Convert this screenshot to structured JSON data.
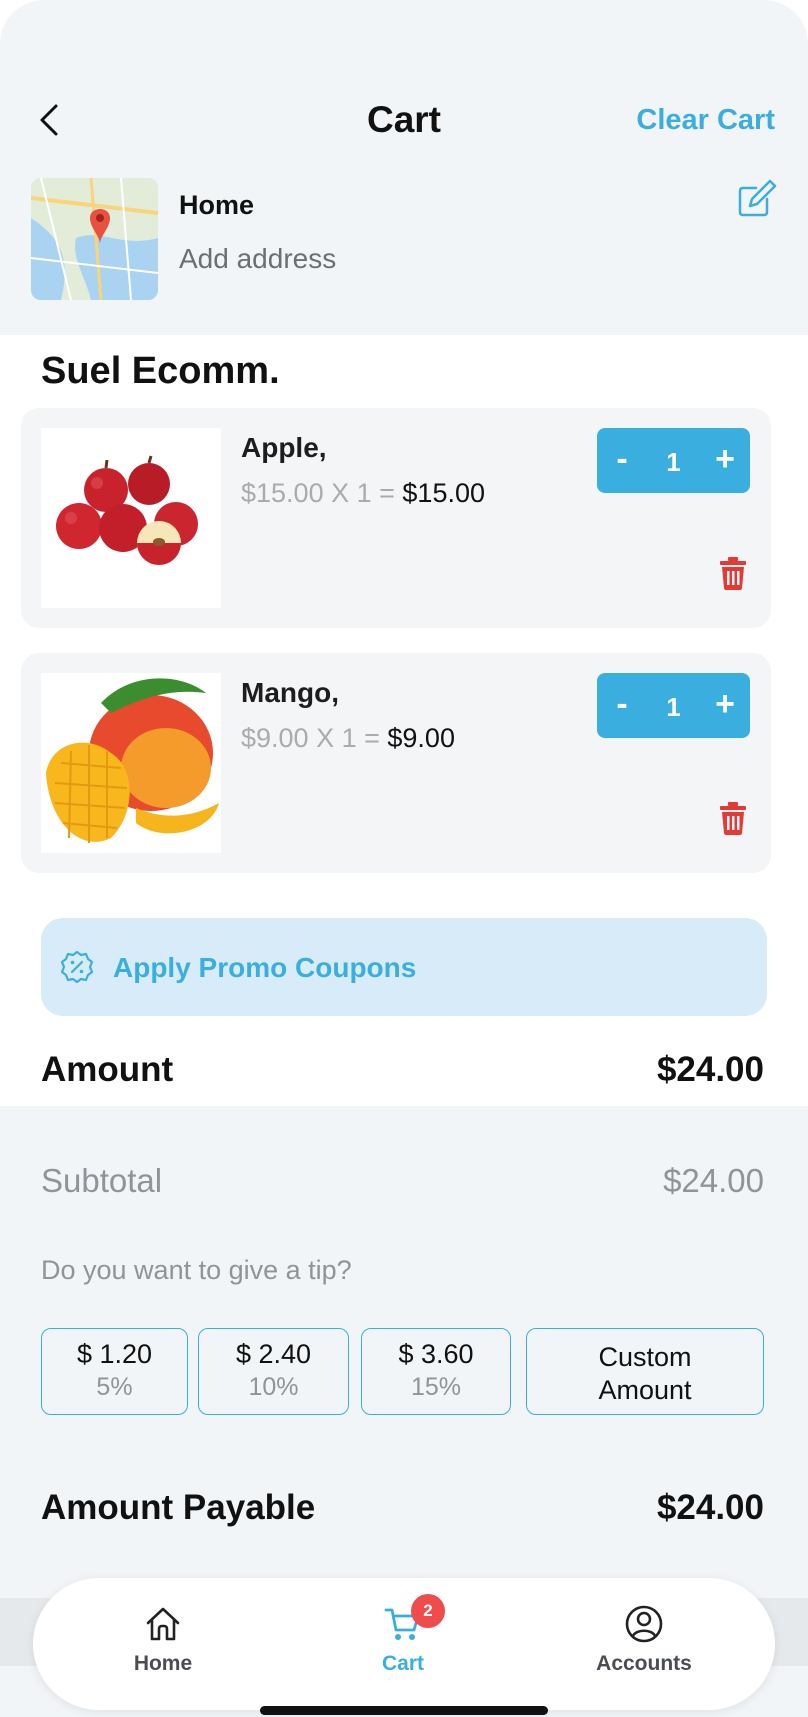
{
  "header": {
    "title": "Cart",
    "clear_label": "Clear Cart"
  },
  "address": {
    "label": "Home",
    "value": "Add address"
  },
  "store": {
    "name": "Suel Ecomm."
  },
  "items": [
    {
      "name": "Apple,",
      "unit_price": "$15.00 X 1 =",
      "line_total": "$15.00",
      "quantity": "1",
      "minus": "-",
      "plus": "+"
    },
    {
      "name": "Mango,",
      "unit_price": "$9.00 X 1 =",
      "line_total": "$9.00",
      "quantity": "1",
      "minus": "-",
      "plus": "+"
    }
  ],
  "promo": {
    "label": "Apply Promo Coupons"
  },
  "amount": {
    "label": "Amount",
    "value": "$24.00"
  },
  "summary": {
    "subtotal_label": "Subtotal",
    "subtotal_value": "$24.00",
    "tip_question": "Do you want to give a tip?",
    "tips": [
      {
        "amount": "$ 1.20",
        "percent": "5%"
      },
      {
        "amount": "$ 2.40",
        "percent": "10%"
      },
      {
        "amount": "$ 3.60",
        "percent": "15%"
      }
    ],
    "custom_tip_line1": "Custom",
    "custom_tip_line2": "Amount",
    "payable_label": "Amount Payable",
    "payable_value": "$24.00"
  },
  "nav": {
    "home": "Home",
    "cart": "Cart",
    "cart_badge": "2",
    "accounts": "Accounts"
  },
  "colors": {
    "accent": "#3aaedf",
    "danger": "#e53935",
    "badge": "#ef4c4c",
    "promo_bg": "#d7ecf8"
  },
  "icons": {
    "back": "chevron-left-icon",
    "edit": "edit-icon",
    "delete": "trash-icon",
    "promo": "discount-icon",
    "home": "home-icon",
    "cart": "cart-icon",
    "accounts": "user-circle-icon"
  }
}
